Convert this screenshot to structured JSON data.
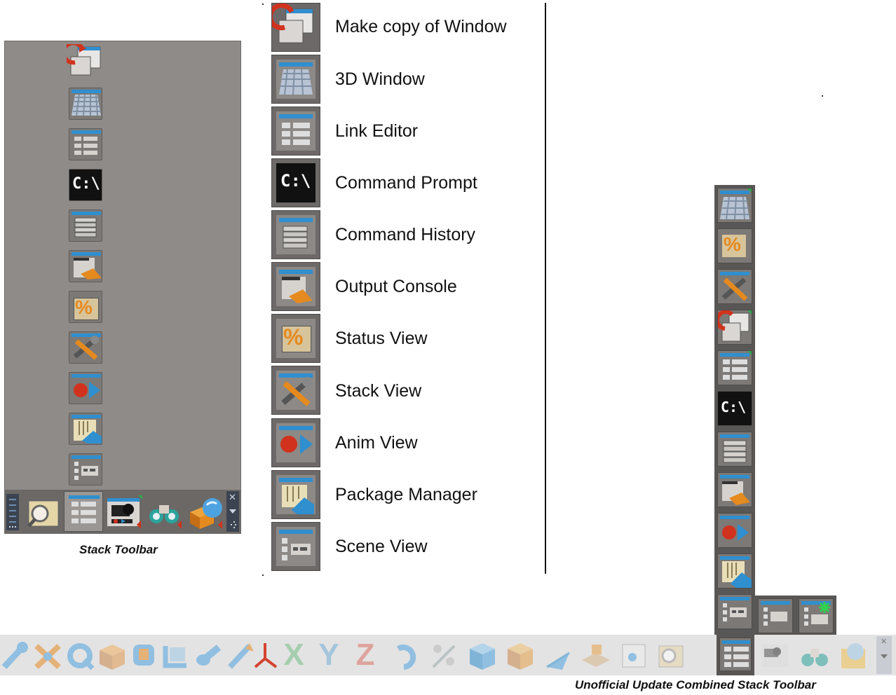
{
  "stack_toolbar": {
    "caption": "Stack Toolbar",
    "close_glyph": "✕",
    "bottom_items": [
      "list-icon",
      "folder-magnifier-icon",
      "link-editor-icon",
      "camera-icon",
      "binoculars-icon",
      "shapes-icon"
    ]
  },
  "legend": {
    "items": [
      {
        "icon": "copy-window-icon",
        "label": "Make copy of Window"
      },
      {
        "icon": "3d-window-icon",
        "label": "3D Window"
      },
      {
        "icon": "link-editor-icon",
        "label": "Link Editor"
      },
      {
        "icon": "command-prompt-icon",
        "label": "Command Prompt",
        "glyph": "C:\\"
      },
      {
        "icon": "command-history-icon",
        "label": "Command History"
      },
      {
        "icon": "output-console-icon",
        "label": "Output Console"
      },
      {
        "icon": "status-view-icon",
        "label": "Status View",
        "glyph": "%"
      },
      {
        "icon": "stack-view-icon",
        "label": "Stack View"
      },
      {
        "icon": "anim-view-icon",
        "label": "Anim View"
      },
      {
        "icon": "package-manager-icon",
        "label": "Package Manager"
      },
      {
        "icon": "scene-view-icon",
        "label": "Scene View"
      }
    ]
  },
  "combined_toolbar": {
    "caption": "Unofficial Update Combined Stack Toolbar",
    "axis_labels": [
      "X",
      "Y",
      "Z"
    ]
  },
  "colors": {
    "panel": "#8f8b88",
    "tile": "#7c7976",
    "window_blue": "#2f8fcf",
    "accent_orange": "#e58a1f",
    "accent_red": "#d1321d"
  }
}
